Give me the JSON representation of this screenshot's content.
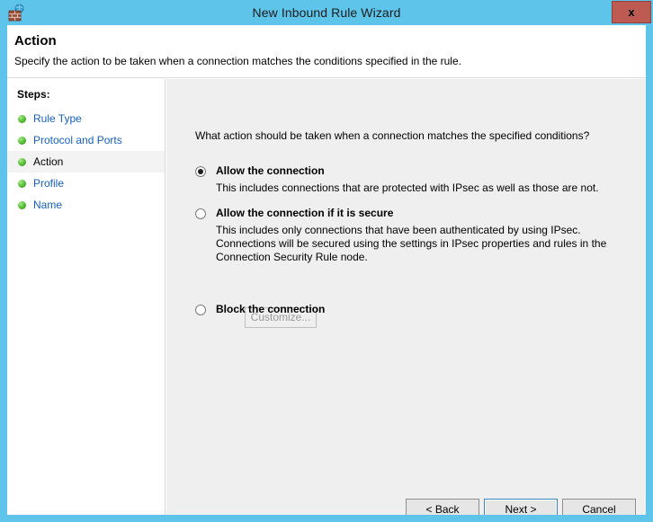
{
  "window": {
    "title": "New Inbound Rule Wizard",
    "icon": "firewall-globe-icon",
    "close_label": "x",
    "titlebar_color": "#5fc4ea",
    "close_color": "#bd5a52"
  },
  "header": {
    "title": "Action",
    "subtitle": "Specify the action to be taken when a connection matches the conditions specified in the rule."
  },
  "sidebar": {
    "label": "Steps:",
    "items": [
      {
        "label": "Rule Type",
        "current": false
      },
      {
        "label": "Protocol and Ports",
        "current": false
      },
      {
        "label": "Action",
        "current": true
      },
      {
        "label": "Profile",
        "current": false
      },
      {
        "label": "Name",
        "current": false
      }
    ],
    "link_color": "#1560bd",
    "bullet_color": "#4cbb2e"
  },
  "main": {
    "question": "What action should be taken when a connection matches the specified conditions?",
    "options": [
      {
        "title": "Allow the connection",
        "description": "This includes connections that are protected with IPsec as well as those are not.",
        "selected": true
      },
      {
        "title": "Allow the connection if it is secure",
        "description": "This includes only connections that have been authenticated by using IPsec.  Connections will be secured using the settings in IPsec properties and rules in the Connection Security Rule node.",
        "selected": false
      },
      {
        "title": "Block the connection",
        "description": "",
        "selected": false
      }
    ],
    "customize_label": "Customize..."
  },
  "footer": {
    "back_label": "< Back",
    "next_label": "Next >",
    "cancel_label": "Cancel"
  }
}
